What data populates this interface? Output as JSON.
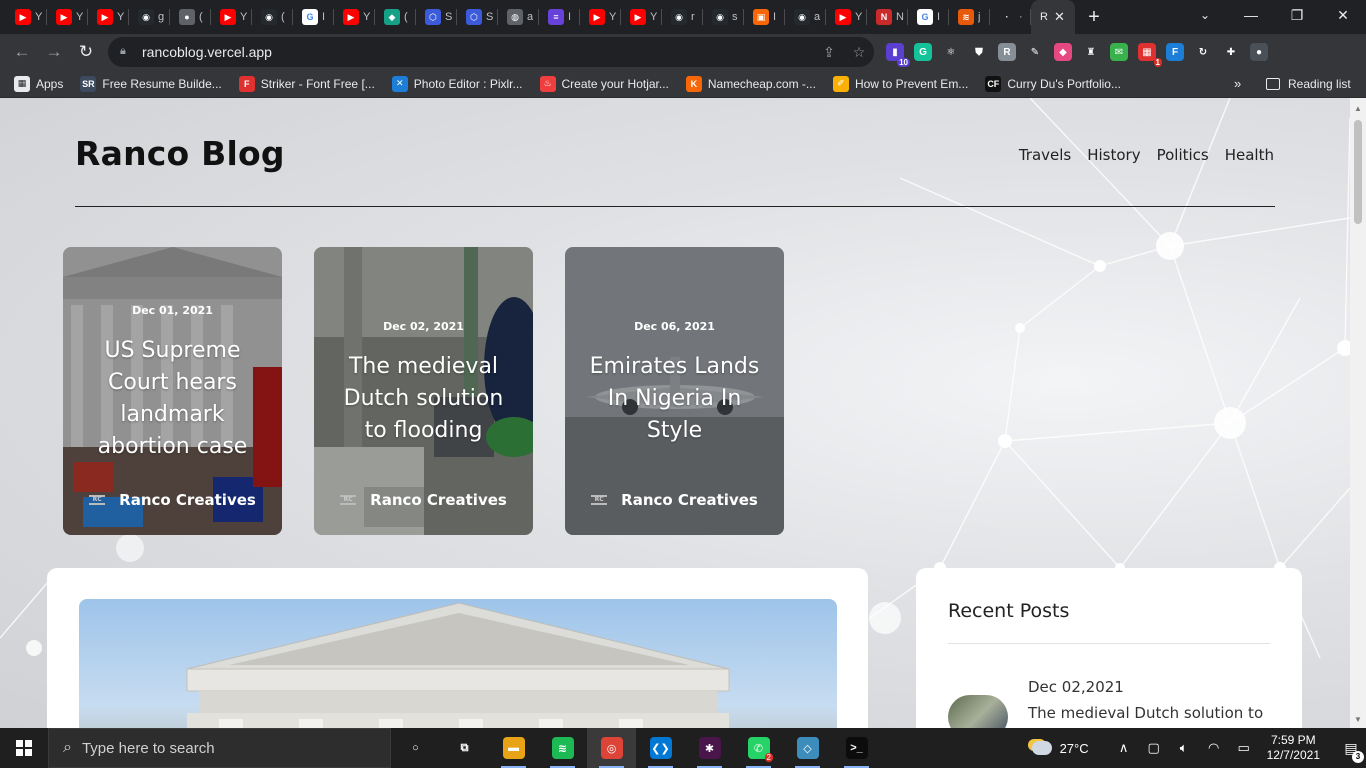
{
  "browser": {
    "tabs": [
      {
        "icon": "youtube-icon",
        "color": "#ff0000",
        "glyph": "▶",
        "title": "Y"
      },
      {
        "icon": "youtube-icon",
        "color": "#ff0000",
        "glyph": "▶",
        "title": "Y"
      },
      {
        "icon": "youtube-icon",
        "color": "#ff0000",
        "glyph": "▶",
        "title": "Y"
      },
      {
        "icon": "github-icon",
        "color": "#24292e",
        "glyph": "◉",
        "title": "g"
      },
      {
        "icon": "users-icon",
        "color": "#5f6368",
        "glyph": "●",
        "title": "("
      },
      {
        "icon": "youtube-icon",
        "color": "#ff0000",
        "glyph": "▶",
        "title": "Y"
      },
      {
        "icon": "github-icon",
        "color": "#24292e",
        "glyph": "◉",
        "title": "("
      },
      {
        "icon": "google-icon",
        "color": "#ffffff",
        "glyph": "G",
        "title": "I"
      },
      {
        "icon": "youtube-icon",
        "color": "#ff0000",
        "glyph": "▶",
        "title": "Y"
      },
      {
        "icon": "diamond-icon",
        "color": "#16a085",
        "glyph": "◆",
        "title": "("
      },
      {
        "icon": "hexagon-icon",
        "color": "#3b5bdb",
        "glyph": "⬡",
        "title": "S"
      },
      {
        "icon": "hexagon-icon",
        "color": "#3b5bdb",
        "glyph": "⬡",
        "title": "S"
      },
      {
        "icon": "globe-icon",
        "color": "#5f6368",
        "glyph": "◍",
        "title": "a"
      },
      {
        "icon": "list-icon",
        "color": "#6741d9",
        "glyph": "≡",
        "title": "I"
      },
      {
        "icon": "youtube-icon",
        "color": "#ff0000",
        "glyph": "▶",
        "title": "Y"
      },
      {
        "icon": "youtube-icon",
        "color": "#ff0000",
        "glyph": "▶",
        "title": "Y"
      },
      {
        "icon": "github-icon",
        "color": "#24292e",
        "glyph": "◉",
        "title": "r"
      },
      {
        "icon": "github-icon",
        "color": "#24292e",
        "glyph": "◉",
        "title": "s"
      },
      {
        "icon": "figma-icon",
        "color": "#f76707",
        "glyph": "▣",
        "title": "I"
      },
      {
        "icon": "github-icon",
        "color": "#24292e",
        "glyph": "◉",
        "title": "a"
      },
      {
        "icon": "youtube-icon",
        "color": "#ff0000",
        "glyph": "▶",
        "title": "Y"
      },
      {
        "icon": "netlify-icon",
        "color": "#c92a2a",
        "glyph": "N",
        "title": "N"
      },
      {
        "icon": "google-icon",
        "color": "#ffffff",
        "glyph": "G",
        "title": "I"
      },
      {
        "icon": "stack-icon",
        "color": "#e8590c",
        "glyph": "≋",
        "title": "j"
      },
      {
        "icon": "dot-icon",
        "color": "#202124",
        "glyph": "·",
        "title": "·"
      }
    ],
    "active_tab": {
      "title": "R"
    },
    "url": "rancoblog.vercel.app",
    "extensions": [
      {
        "icon": "stack-ext-icon",
        "color": "#5b3fd1",
        "glyph": "▮",
        "badge": "10"
      },
      {
        "icon": "grammarly-icon",
        "color": "#15c39a",
        "glyph": "G",
        "badge": ""
      },
      {
        "icon": "react-icon",
        "color": "#35363a",
        "glyph": "⚛",
        "badge": ""
      },
      {
        "icon": "shield-icon",
        "color": "#35363a",
        "glyph": "⛊",
        "badge": ""
      },
      {
        "icon": "r-ext-icon",
        "color": "#868e96",
        "glyph": "R",
        "badge": ""
      },
      {
        "icon": "pen-icon",
        "color": "#35363a",
        "glyph": "✎",
        "badge": ""
      },
      {
        "icon": "color-icon",
        "color": "#e64980",
        "glyph": "◆",
        "badge": ""
      },
      {
        "icon": "flask-icon",
        "color": "#35363a",
        "glyph": "♜",
        "badge": ""
      },
      {
        "icon": "mail-icon",
        "color": "#37b24d",
        "glyph": "✉",
        "badge": ""
      },
      {
        "icon": "grid-ext-icon",
        "color": "#e03131",
        "glyph": "▦",
        "badge": "1"
      },
      {
        "icon": "fi-icon",
        "color": "#1c7ed6",
        "glyph": "F",
        "badge": ""
      },
      {
        "icon": "refresh-ext-icon",
        "color": "#35363a",
        "glyph": "↻",
        "badge": ""
      },
      {
        "icon": "puzzle-icon",
        "color": "#35363a",
        "glyph": "✚",
        "badge": ""
      },
      {
        "icon": "profile-avatar-icon",
        "color": "#495057",
        "glyph": "●",
        "badge": ""
      }
    ],
    "bookmarks": [
      {
        "icon": "apps-grid-icon",
        "color": "#e8eaed",
        "glyph": "▦",
        "label": "Apps"
      },
      {
        "icon": "sr-icon",
        "color": "#3d4a5e",
        "glyph": "SR",
        "label": "Free Resume Builde..."
      },
      {
        "icon": "font-icon",
        "color": "#e03131",
        "glyph": "F",
        "label": "Striker - Font Free [..."
      },
      {
        "icon": "pixlr-icon",
        "color": "#1c7ed6",
        "glyph": "✕",
        "label": "Photo Editor : Pixlr..."
      },
      {
        "icon": "hotjar-icon",
        "color": "#f03e3e",
        "glyph": "♨",
        "label": "Create your Hotjar..."
      },
      {
        "icon": "namecheap-icon",
        "color": "#f76707",
        "glyph": "K",
        "label": "Namecheap.com -..."
      },
      {
        "icon": "feather-icon",
        "color": "#fab005",
        "glyph": "✐",
        "label": "How to Prevent Em..."
      },
      {
        "icon": "cf-icon",
        "color": "#111111",
        "glyph": "CF",
        "label": "Curry Du's Portfolio..."
      }
    ],
    "reading_list": "Reading list",
    "more": "»"
  },
  "site": {
    "title": "Ranco Blog",
    "nav": [
      "Travels",
      "History",
      "Politics",
      "Health"
    ],
    "featured": [
      {
        "date": "Dec 01, 2021",
        "title": "US Supreme Court hears landmark abortion case",
        "author": "Ranco Creatives"
      },
      {
        "date": "Dec 02, 2021",
        "title": "The medieval Dutch solution to flooding",
        "author": "Ranco Creatives"
      },
      {
        "date": "Dec 06, 2021",
        "title": "Emirates Lands In Nigeria In Style",
        "author": "Ranco Creatives"
      }
    ],
    "sidebar": {
      "heading": "Recent Posts",
      "posts": [
        {
          "date": "Dec 02,2021",
          "title": "The medieval Dutch solution to"
        }
      ]
    }
  },
  "taskbar": {
    "search_placeholder": "Type here to search",
    "apps": [
      {
        "icon": "cortana-icon",
        "color": "#1f1f1f",
        "glyph": "○"
      },
      {
        "icon": "task-view-icon",
        "color": "#1f1f1f",
        "glyph": "⧉"
      },
      {
        "icon": "file-explorer-icon",
        "color": "#e8a317",
        "glyph": "▬"
      },
      {
        "icon": "spotify-icon",
        "color": "#1db954",
        "glyph": "≋"
      },
      {
        "icon": "chrome-icon",
        "color": "#db4437",
        "glyph": "◎"
      },
      {
        "icon": "vscode-icon",
        "color": "#0078d4",
        "glyph": "❮❯"
      },
      {
        "icon": "slack-icon",
        "color": "#4a154b",
        "glyph": "✱"
      },
      {
        "icon": "whatsapp-icon",
        "color": "#25d366",
        "glyph": "✆",
        "badge": "2"
      },
      {
        "icon": "git-icon",
        "color": "#3c8dbc",
        "glyph": "◇"
      },
      {
        "icon": "terminal-icon",
        "color": "#0c0c0c",
        "glyph": ">_"
      }
    ],
    "temperature": "27°C",
    "time": "7:59 PM",
    "date": "12/7/2021",
    "notification_count": "3"
  }
}
